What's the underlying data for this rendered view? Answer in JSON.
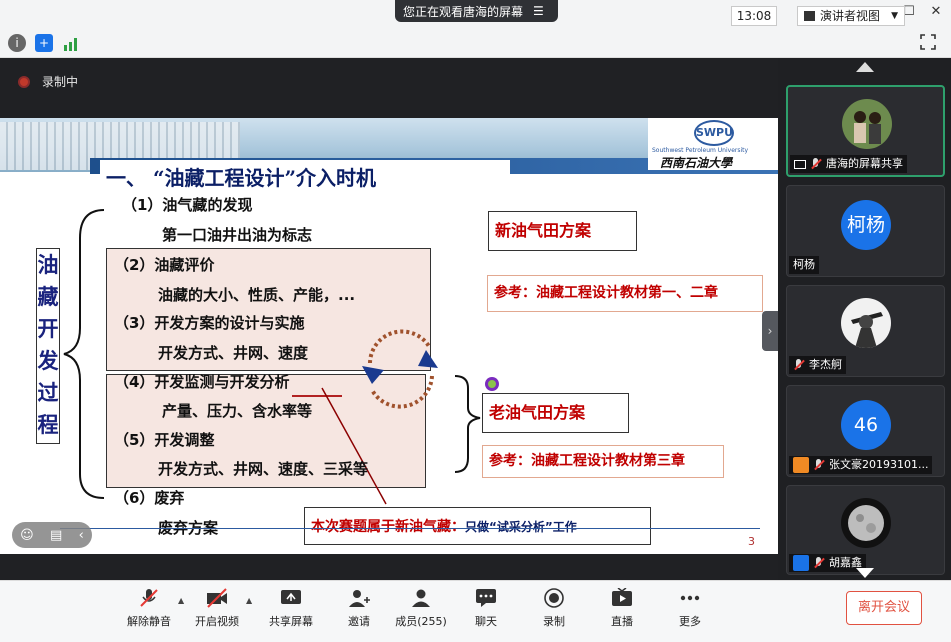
{
  "share_banner": {
    "text": "您正在观看唐海的屏幕"
  },
  "toolbar": {
    "time": "13:08",
    "view_mode": "演讲者视图"
  },
  "recording": {
    "label": "录制中"
  },
  "slide": {
    "title": "一、 “油藏工程设计”介入时机",
    "logo_en": "Southwest Petroleum University",
    "logo_cn": "西南石油大學",
    "vertical_title": "油藏开发过程",
    "items": [
      "（1）油气藏的发现",
      "第一口油井出油为标志",
      "（2）油藏评价",
      "油藏的大小、性质、产能，...",
      "（3）开发方案的设计与实施",
      "开发方式、井网、速度",
      "（4）开发监测与开发分析",
      "产量、压力、含水率等",
      "（5）开发调整",
      "开发方式、井网、速度、三采等",
      "（6）废弃",
      "废弃方案"
    ],
    "new_plan": "新油气田方案",
    "new_ref": "参考：油藏工程设计教材第一、二章",
    "old_plan": "老油气田方案",
    "old_ref": "参考：油藏工程设计教材第三章",
    "note_bold": "本次赛题属于新油气藏：",
    "note_rest": "只做“试采分析”工作",
    "page_number": "3"
  },
  "participants": [
    {
      "name": "唐海的屏幕共享",
      "avatar": "photo",
      "active": true
    },
    {
      "name": "柯杨",
      "avatar_text": "柯杨"
    },
    {
      "name": "李杰舸",
      "avatar": "photo"
    },
    {
      "name": "张文豪20193101...",
      "avatar_text": "46"
    },
    {
      "name": "胡嘉鑫",
      "avatar": "photo"
    }
  ],
  "bottom": {
    "mute": "解除静音",
    "video": "开启视频",
    "share": "共享屏幕",
    "invite": "邀请",
    "members": "成员(255)",
    "chat": "聊天",
    "record": "录制",
    "live": "直播",
    "more": "更多",
    "leave": "离开会议"
  },
  "colors": {
    "accent_green": "#2ea06c",
    "leave_red": "#e15241",
    "slide_red": "#c00000",
    "title_navy": "#0b1f66"
  }
}
